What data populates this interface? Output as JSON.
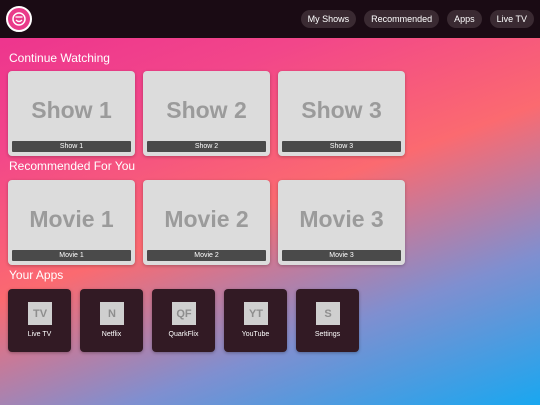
{
  "header": {
    "logo_icon": "smiley-tv-icon",
    "nav": [
      "My Shows",
      "Recommended",
      "Apps",
      "Live TV"
    ]
  },
  "continue_watching": {
    "title": "Continue Watching",
    "items": [
      {
        "art": "Show 1",
        "label": "Show 1"
      },
      {
        "art": "Show 2",
        "label": "Show 2"
      },
      {
        "art": "Show 3",
        "label": "Show 3"
      }
    ]
  },
  "recommended": {
    "title": "Recommended For You",
    "items": [
      {
        "art": "Movie 1",
        "label": "Movie 1"
      },
      {
        "art": "Movie 2",
        "label": "Movie 2"
      },
      {
        "art": "Movie 3",
        "label": "Movie 3"
      }
    ]
  },
  "apps": {
    "title": "Your Apps",
    "items": [
      {
        "icon": "TV",
        "label": "Live TV"
      },
      {
        "icon": "N",
        "label": "Netflix"
      },
      {
        "icon": "QF",
        "label": "QuarkFlix"
      },
      {
        "icon": "YT",
        "label": "YouTube"
      },
      {
        "icon": "S",
        "label": "Settings"
      }
    ]
  }
}
